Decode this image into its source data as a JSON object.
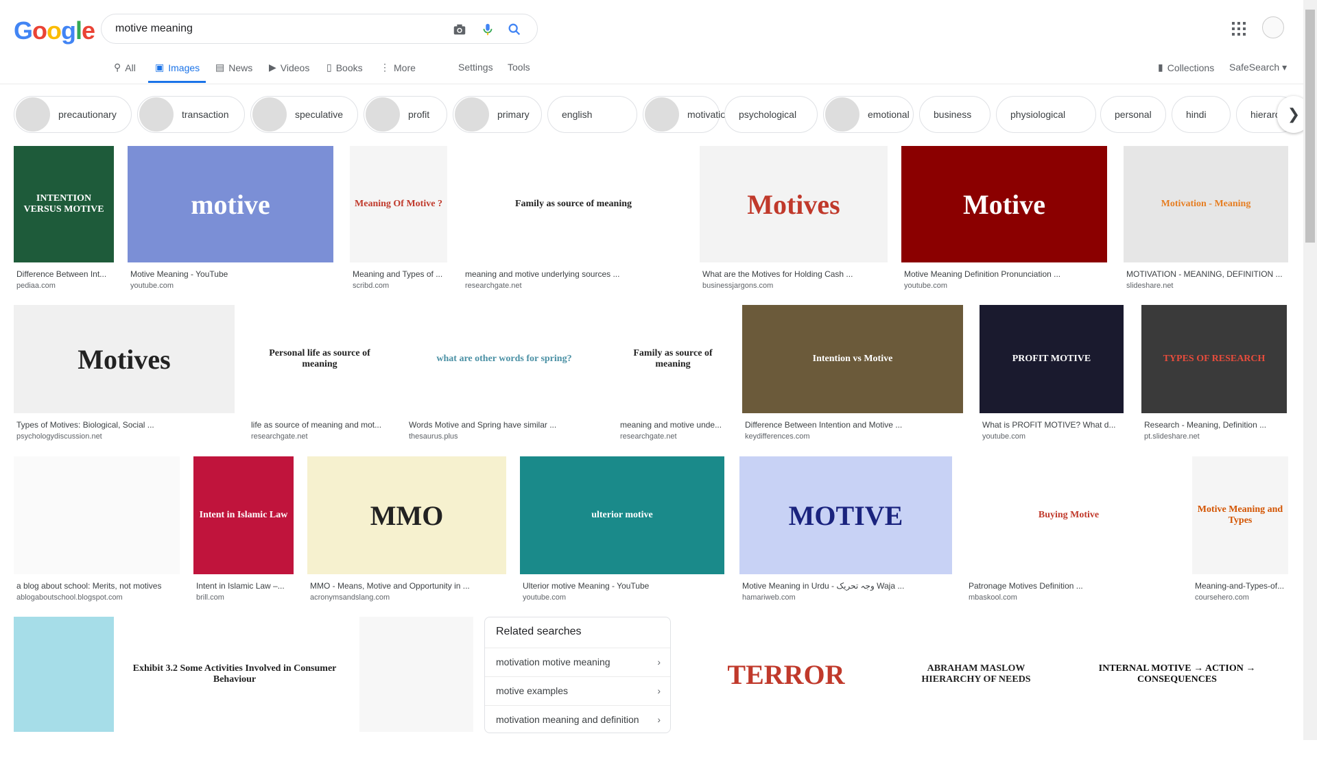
{
  "logo": {
    "letters": [
      "G",
      "o",
      "o",
      "g",
      "l",
      "e"
    ],
    "colors": [
      "#4285f4",
      "#ea4335",
      "#fbbc05",
      "#4285f4",
      "#34a853",
      "#ea4335"
    ]
  },
  "search": {
    "query": "motive meaning"
  },
  "tabs": [
    {
      "label": "All",
      "icon": "search-icon"
    },
    {
      "label": "Images",
      "icon": "image-icon"
    },
    {
      "label": "News",
      "icon": "news-icon"
    },
    {
      "label": "Videos",
      "icon": "video-icon"
    },
    {
      "label": "Books",
      "icon": "book-icon"
    },
    {
      "label": "More",
      "icon": "kebab-icon"
    }
  ],
  "tools": {
    "settings": "Settings",
    "tools": "Tools"
  },
  "right_links": {
    "collections": "Collections",
    "safesearch": "SafeSearch"
  },
  "chips": [
    "precautionary",
    "transaction",
    "speculative",
    "profit",
    "primary",
    "english",
    "motivation",
    "psychological",
    "emotional",
    "business",
    "physiological",
    "personal",
    "hindi",
    "hierarchy"
  ],
  "results": [
    {
      "caption": "Difference Between Int...",
      "source": "pediaa.com",
      "text": "INTENTION VERSUS MOTIVE",
      "bg": "#1e5b3a",
      "fg": "#ffffff"
    },
    {
      "caption": "Motive Meaning - YouTube",
      "source": "youtube.com",
      "text": "motive",
      "bg": "#7b8fd6",
      "fg": "#ffffff"
    },
    {
      "caption": "Meaning and Types of ...",
      "source": "scribd.com",
      "text": "Meaning Of Motive ?",
      "bg": "#f5f5f5",
      "fg": "#c0392b"
    },
    {
      "caption": "meaning and motive underlying sources ...",
      "source": "researchgate.net",
      "text": "Family as source of meaning",
      "bg": "#ffffff",
      "fg": "#222222"
    },
    {
      "caption": "What are the Motives for Holding Cash ...",
      "source": "businessjargons.com",
      "text": "Motives",
      "bg": "#f3f3f3",
      "fg": "#c0392b"
    },
    {
      "caption": "Motive Meaning Definition Pronunciation ...",
      "source": "youtube.com",
      "text": "Motive",
      "bg": "#8b0000",
      "fg": "#ffffff"
    },
    {
      "caption": "MOTIVATION - MEANING, DEFINITION ...",
      "source": "slideshare.net",
      "text": "Motivation - Meaning",
      "bg": "#e6e6e6",
      "fg": "#e67e22"
    },
    {
      "caption": "Types of Motives: Biological, Social ...",
      "source": "psychologydiscussion.net",
      "text": "Motives",
      "bg": "#f0f0f0",
      "fg": "#222222"
    },
    {
      "caption": "life as source of meaning and mot...",
      "source": "researchgate.net",
      "text": "Personal life as source of meaning",
      "bg": "#ffffff",
      "fg": "#222222"
    },
    {
      "caption": "Words Motive and Spring have similar ...",
      "source": "thesaurus.plus",
      "text": "what are other words for spring?",
      "bg": "#ffffff",
      "fg": "#4a90a4"
    },
    {
      "caption": "meaning and motive unde...",
      "source": "researchgate.net",
      "text": "Family as source of meaning",
      "bg": "#ffffff",
      "fg": "#222222"
    },
    {
      "caption": "Difference Between Intention and Motive ...",
      "source": "keydifferences.com",
      "text": "Intention vs Motive",
      "bg": "#6b5a3a",
      "fg": "#ffffff"
    },
    {
      "caption": "What is PROFIT MOTIVE? What d...",
      "source": "youtube.com",
      "text": "PROFIT MOTIVE",
      "bg": "#1a1a2e",
      "fg": "#ffffff"
    },
    {
      "caption": "Research - Meaning, Definition ...",
      "source": "pt.slideshare.net",
      "text": "TYPES OF RESEARCH",
      "bg": "#3a3a3a",
      "fg": "#e74c3c"
    },
    {
      "caption": "a blog about school: Merits, not motives",
      "source": "ablogaboutschool.blogspot.com",
      "text": "",
      "bg": "#fafafa",
      "fg": "#333333"
    },
    {
      "caption": "Intent in Islamic Law –...",
      "source": "brill.com",
      "text": "Intent in Islamic Law",
      "bg": "#c0143c",
      "fg": "#ffffff"
    },
    {
      "caption": "MMO - Means, Motive and Opportunity in ...",
      "source": "acronymsandslang.com",
      "text": "MMO",
      "bg": "#f6f1cf",
      "fg": "#222222"
    },
    {
      "caption": "Ulterior motive Meaning - YouTube",
      "source": "youtube.com",
      "text": "ulterior motive",
      "bg": "#1a8a8a",
      "fg": "#ffffff"
    },
    {
      "caption": "Motive Meaning in Urdu - وجہ تحریک Waja ...",
      "source": "hamariweb.com",
      "text": "MOTIVE",
      "bg": "#c8d2f5",
      "fg": "#1a237e"
    },
    {
      "caption": "Patronage Motives Definition ...",
      "source": "mbaskool.com",
      "text": "Buying Motive",
      "bg": "#ffffff",
      "fg": "#c0392b"
    },
    {
      "caption": "Meaning-and-Types-of...",
      "source": "coursehero.com",
      "text": "Motive Meaning and Types",
      "bg": "#f5f5f5",
      "fg": "#d35400"
    },
    {
      "caption": "",
      "source": "",
      "text": "",
      "bg": "#a6dde8",
      "fg": "#333333"
    },
    {
      "caption": "",
      "source": "",
      "text": "Exhibit 3.2 Some Activities Involved in Consumer Behaviour",
      "bg": "#ffffff",
      "fg": "#222222"
    },
    {
      "caption": "",
      "source": "",
      "text": "",
      "bg": "#f7f7f7",
      "fg": "#222222"
    },
    {
      "caption": "",
      "source": "",
      "text": "TERROR",
      "bg": "#ffffff",
      "fg": "#c0392b"
    },
    {
      "caption": "",
      "source": "",
      "text": "ABRAHAM MASLOW HIERARCHY OF NEEDS",
      "bg": "#ffffff",
      "fg": "#222222"
    },
    {
      "caption": "",
      "source": "",
      "text": "INTERNAL MOTIVE → ACTION → CONSEQUENCES",
      "bg": "#ffffff",
      "fg": "#111111"
    }
  ],
  "related": {
    "title": "Related searches",
    "items": [
      "motivation motive meaning",
      "motive examples",
      "motivation meaning and definition"
    ]
  }
}
